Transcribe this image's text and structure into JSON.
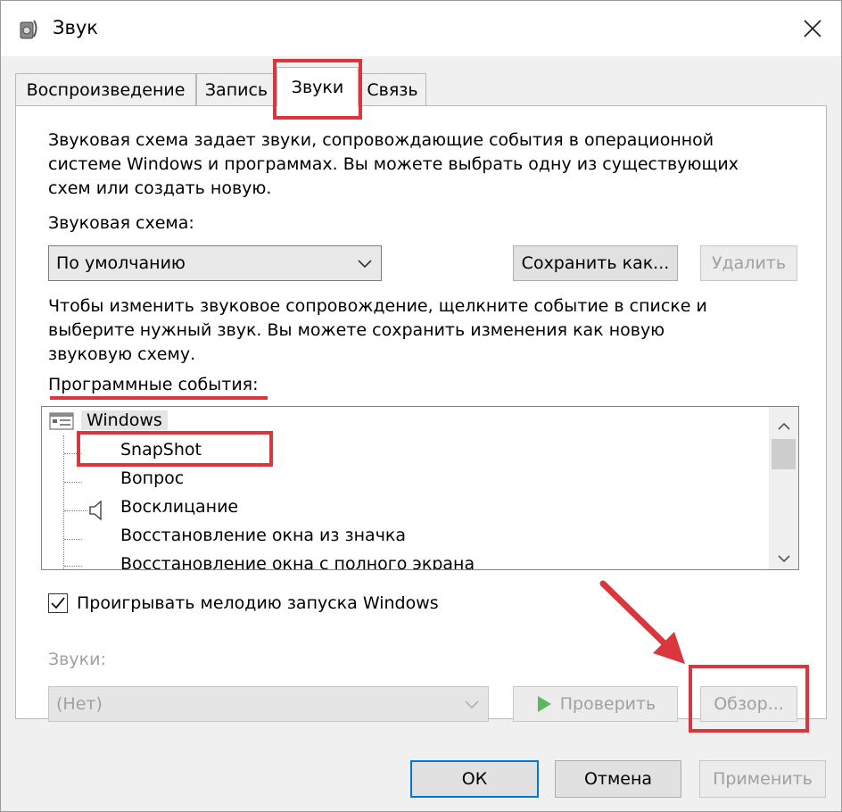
{
  "window": {
    "title": "Звук"
  },
  "tabs": [
    {
      "label": "Воспроизведение"
    },
    {
      "label": "Запись"
    },
    {
      "label": "Звуки"
    },
    {
      "label": "Связь"
    }
  ],
  "intro": {
    "line1": "Звуковая схема задает звуки, сопровождающие события в операционной",
    "line2": "системе Windows и программах. Вы можете выбрать одну из существующих",
    "line3": "схем или создать новую."
  },
  "scheme": {
    "label": "Звуковая схема:",
    "value": "По умолчанию",
    "save_label": "Сохранить как...",
    "delete_label": "Удалить"
  },
  "hint": {
    "line1": "Чтобы изменить звуковое сопровождение, щелкните событие в списке и",
    "line2": "выберите нужный звук. Вы можете сохранить изменения как новую",
    "line3": "звуковую схему."
  },
  "events": {
    "label": "Программные события:",
    "group": "Windows",
    "items": [
      "SnapShot",
      "Вопрос",
      "Восклицание",
      "Восстановление окна из значка",
      "Восстановление окна с полного экрана"
    ]
  },
  "startup": {
    "label": "Проигрывать мелодию запуска Windows",
    "checked": true
  },
  "sounds": {
    "label": "Звуки:",
    "value": "(Нет)",
    "test_label": "Проверить",
    "browse_label": "Обзор..."
  },
  "footer": {
    "ok": "ОК",
    "cancel": "Отмена",
    "apply": "Применить"
  },
  "colors": {
    "annotation": "#d9363e",
    "play": "#5cb85c"
  }
}
